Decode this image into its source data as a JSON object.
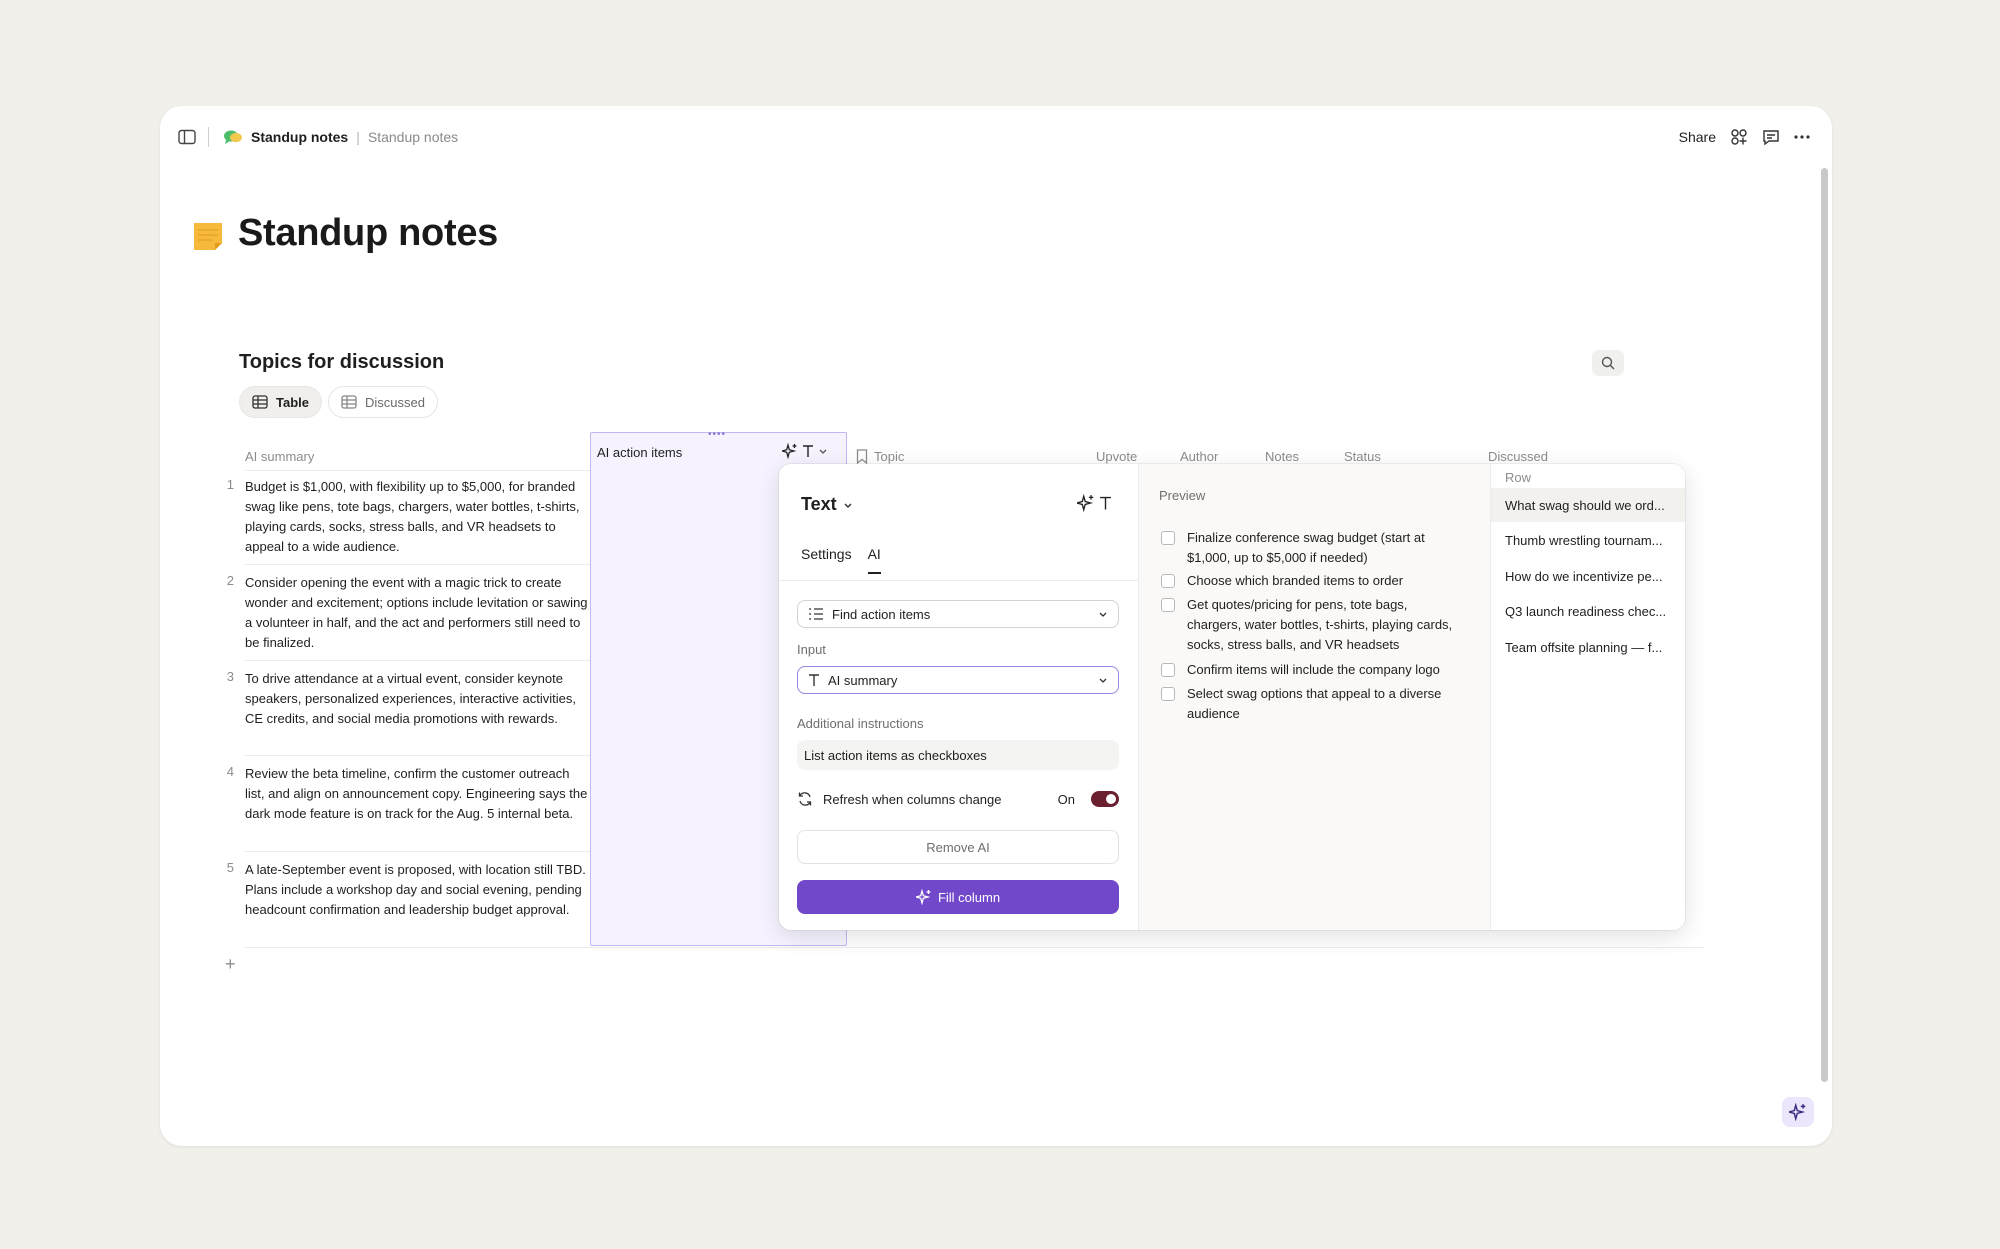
{
  "breadcrumb": {
    "main": "Standup notes",
    "sub": "Standup notes"
  },
  "toolbar": {
    "share_label": "Share"
  },
  "page": {
    "title": "Standup notes"
  },
  "database": {
    "title": "Topics for discussion",
    "views": [
      {
        "label": "Table"
      },
      {
        "label": "Discussed"
      }
    ],
    "columns": {
      "ai_summary": "AI summary",
      "ai_action_items": "AI action items",
      "topic": "Topic",
      "upvote": "Upvote",
      "author": "Author",
      "notes": "Notes",
      "status": "Status",
      "discussed": "Discussed"
    },
    "rows": [
      {
        "num": "1",
        "summary": "Budget is $1,000, with flexibility up to $5,000, for branded swag like pens, tote bags, chargers, water bottles, t-shirts, playing cards, socks, stress balls, and VR headsets to appeal to a wide audience."
      },
      {
        "num": "2",
        "summary": "Consider opening the event with a magic trick to create wonder and excitement; options include levitation or sawing a volunteer in half, and the act and performers still need to be finalized."
      },
      {
        "num": "3",
        "summary": "To drive attendance at a virtual event, consider keynote speakers, personalized experiences, interactive activities, CE credits, and social media promotions with rewards."
      },
      {
        "num": "4",
        "summary": "Review the beta timeline, confirm the customer outreach list, and align on announcement copy. Engineering says the dark mode feature is on track for the Aug. 5 internal beta."
      },
      {
        "num": "5",
        "summary": "A late-September event is proposed, with location still TBD. Plans include a workshop day and social evening, pending headcount confirmation and leadership budget approval."
      }
    ],
    "add_row": "+"
  },
  "popover": {
    "type_label": "Text",
    "tabs": [
      {
        "label": "Settings"
      },
      {
        "label": "AI"
      }
    ],
    "action_select": "Find action items",
    "input_label": "Input",
    "input_select": "AI summary",
    "instructions_label": "Additional instructions",
    "instructions_value": "List action items as checkboxes",
    "refresh_label": "Refresh when columns change",
    "refresh_state": "On",
    "remove_button": "Remove AI",
    "fill_button": "Fill column",
    "preview_label": "Preview",
    "preview_items": [
      "Finalize conference swag budget (start at $1,000, up to $5,000 if needed)",
      "Choose which branded items to order",
      "Get quotes/pricing for pens, tote bags, chargers, water bottles, t-shirts, playing cards, socks, stress balls, and VR headsets",
      "Confirm items will include the company logo",
      "Select swag options that appeal to a diverse audience"
    ],
    "row_label": "Row",
    "row_items": [
      "What swag should we ord...",
      "Thumb wrestling tournam...",
      "How do we incentivize pe...",
      "Q3 launch readiness chec...",
      "Team offsite planning — f..."
    ]
  },
  "colors": {
    "accent": "#7148c9",
    "toggle_on": "#6b2030",
    "ai_column_bg": "#f6f3fe"
  }
}
